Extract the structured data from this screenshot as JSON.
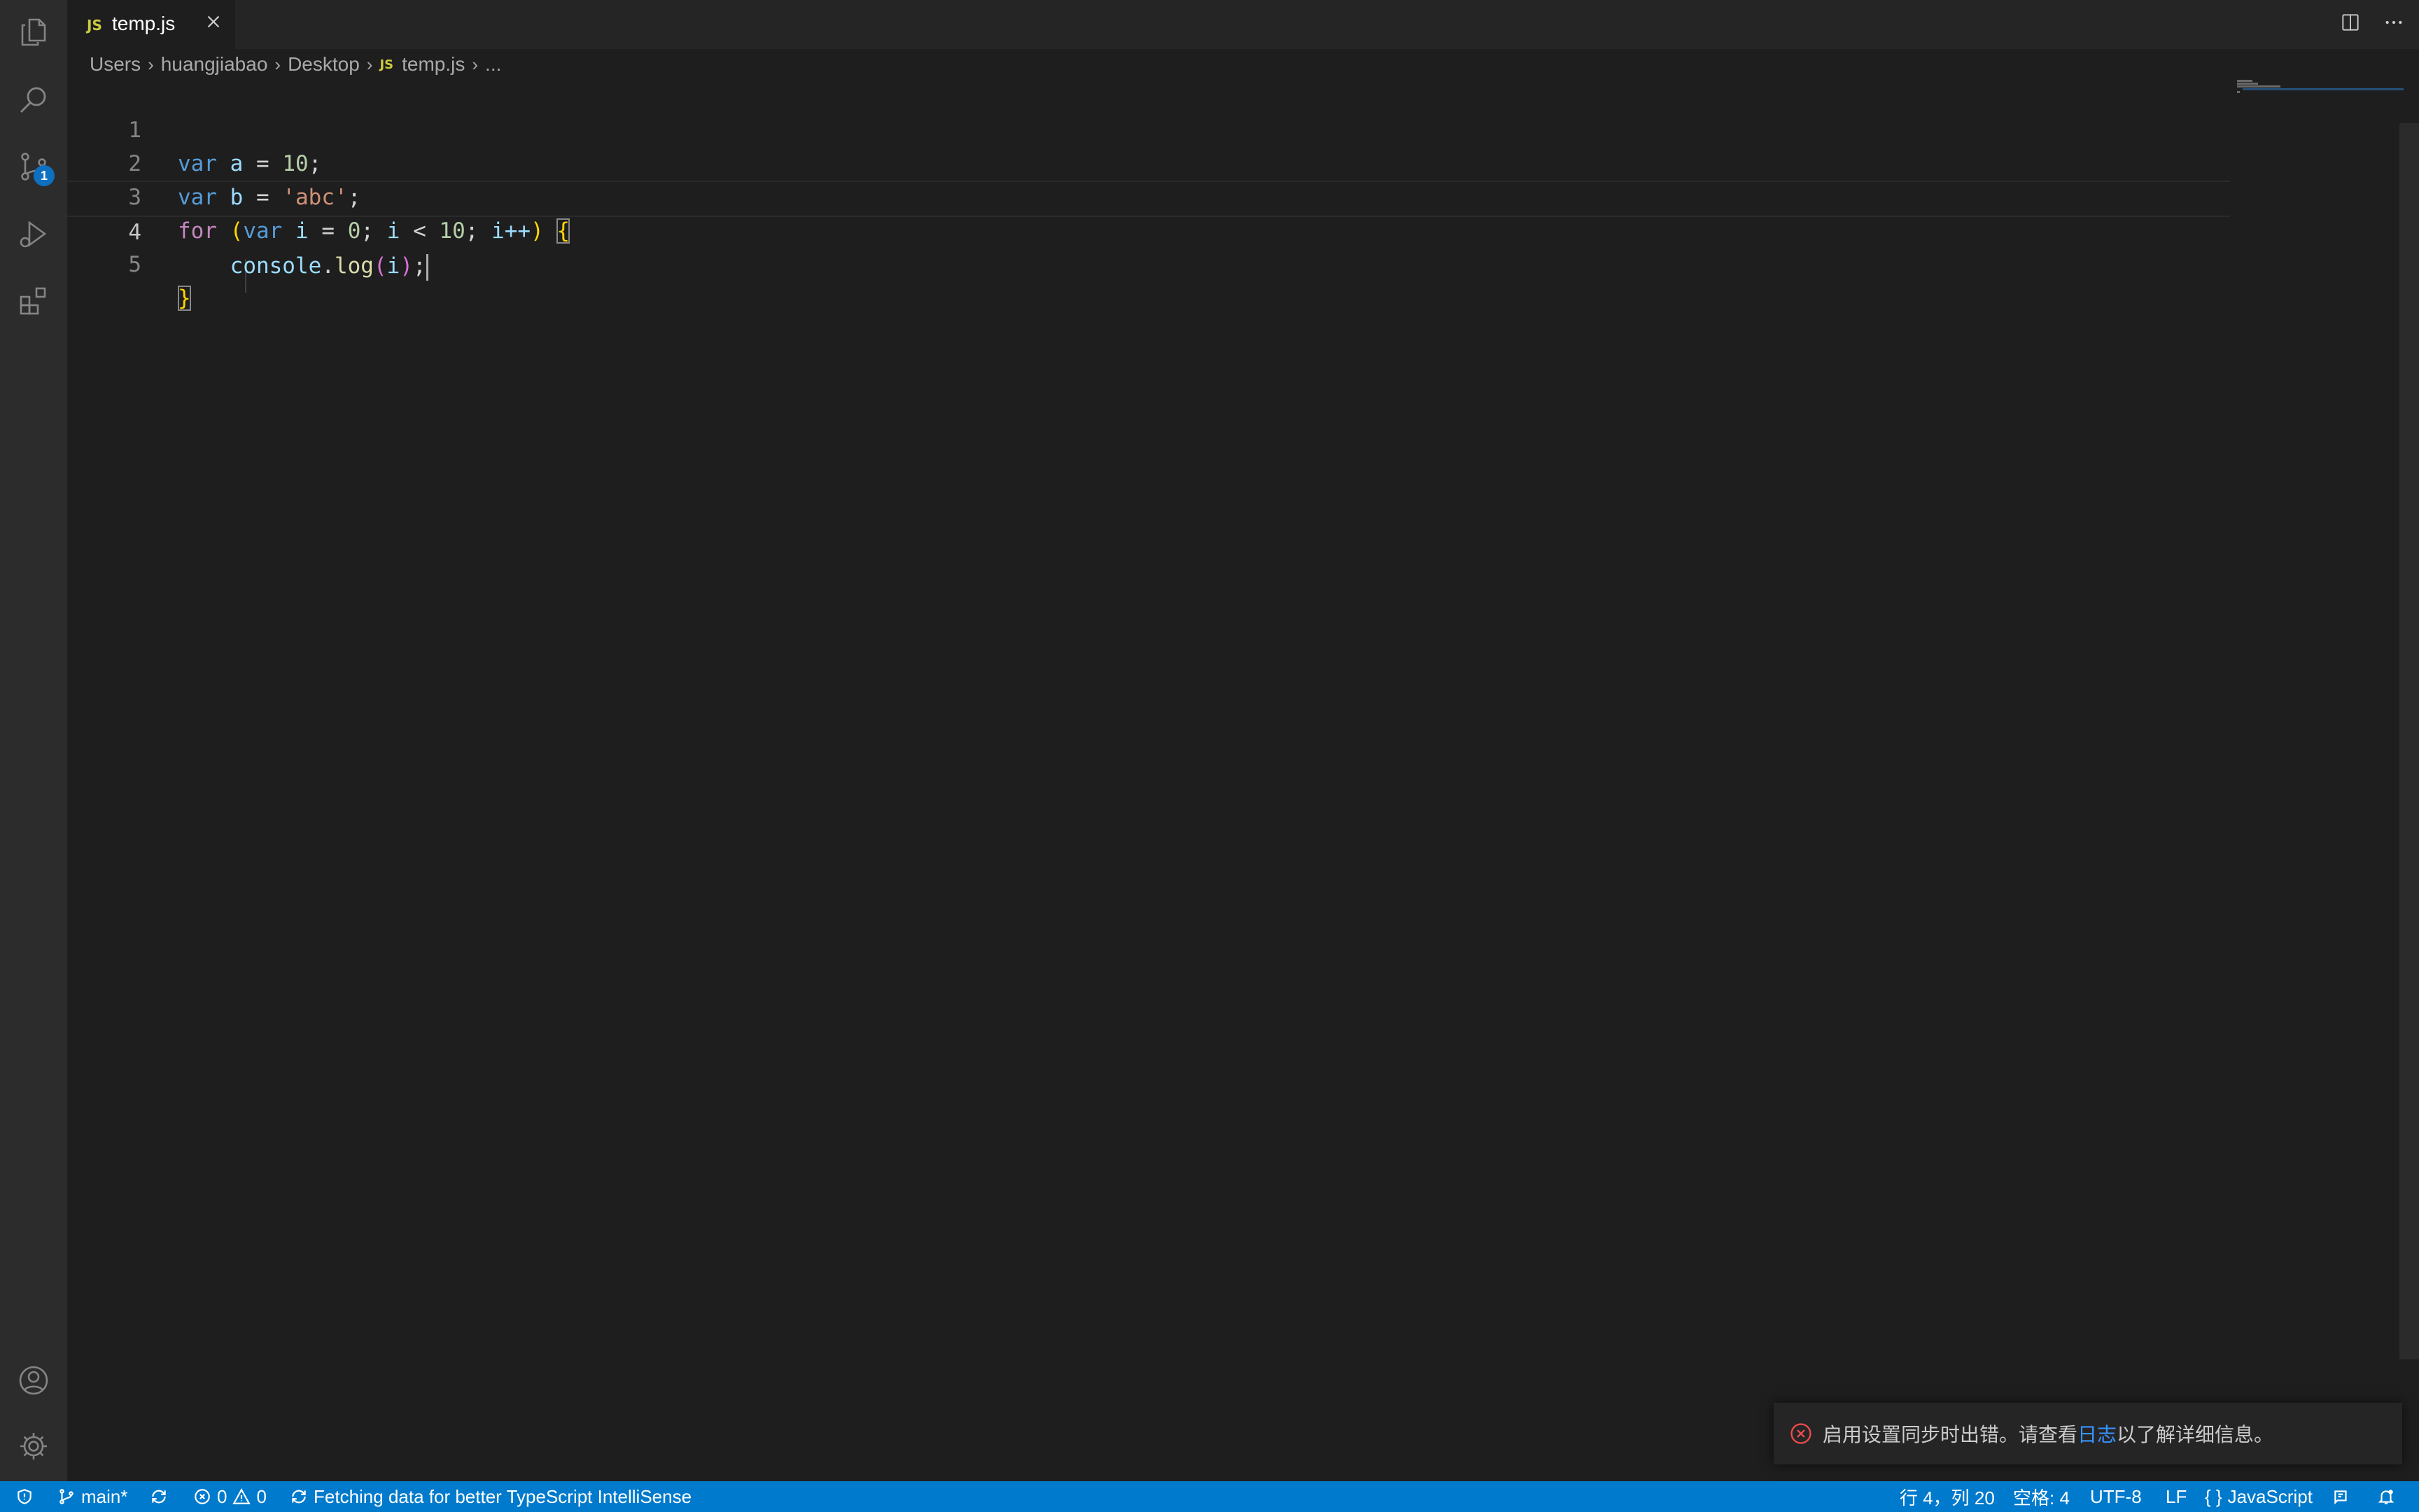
{
  "activity_bar": {
    "items": [
      "explorer-icon",
      "search-icon",
      "source-control-icon",
      "run-debug-icon",
      "extensions-icon"
    ],
    "source_control_badge": "1",
    "bottom_items": [
      "account-icon",
      "settings-gear-icon"
    ]
  },
  "tab": {
    "icon_text": "JS",
    "label": "temp.js"
  },
  "breadcrumb": {
    "items": [
      "Users",
      "huangjiabao",
      "Desktop"
    ],
    "file_icon_text": "JS",
    "file": "temp.js",
    "more": "..."
  },
  "editor": {
    "line_numbers": [
      "1",
      "2",
      "3",
      "4",
      "5"
    ],
    "lines": [
      "var a = 10;",
      "var b = 'abc';",
      "for (var i = 0; i < 10; i++) {",
      "    console.log(i);",
      "}"
    ],
    "tokens": {
      "l1": [
        "var",
        "a",
        "=",
        "10",
        ";"
      ],
      "l2": [
        "var",
        "b",
        "=",
        "'abc'",
        ";"
      ],
      "l3": [
        "for",
        "(",
        "var",
        "i",
        "=",
        "0",
        ";",
        "i",
        "<",
        "10",
        ";",
        "i++",
        ")",
        "{"
      ],
      "l4": [
        "console",
        ".",
        "log",
        "(",
        "i",
        ")",
        ";"
      ],
      "l5": [
        "}"
      ]
    },
    "current_line": 4
  },
  "notification": {
    "text_before": "启用设置同步时出错。请查看",
    "link": "日志",
    "text_after": "以了解详细信息。"
  },
  "status_bar": {
    "branch": "main*",
    "errors": "0",
    "warnings": "0",
    "message": "Fetching data for better TypeScript IntelliSense",
    "position": "行 4，列 20",
    "spaces": "空格: 4",
    "encoding": "UTF-8",
    "eol": "LF",
    "language": "JavaScript"
  },
  "colors": {
    "status_bar": "#007acc",
    "editor_bg": "#1e1e1e",
    "badge": "#0e70c0",
    "error": "#f14c4c"
  }
}
